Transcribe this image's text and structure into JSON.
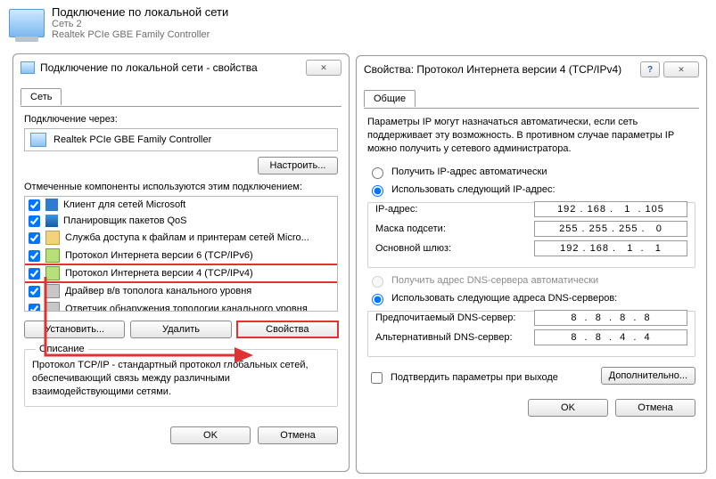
{
  "header": {
    "title": "Подключение по локальной сети",
    "sub1": "Сеть 2",
    "sub2": "Realtek PCIe GBE Family Controller"
  },
  "dlg1": {
    "title": "Подключение по локальной сети - свойства",
    "tab": "Сеть",
    "connect_via": "Подключение через:",
    "adapter": "Realtek PCIe GBE Family Controller",
    "configure": "Настроить...",
    "components_label": "Отмеченные компоненты используются этим подключением:",
    "items": [
      "Клиент для сетей Microsoft",
      "Планировщик пакетов QoS",
      "Служба доступа к файлам и принтерам сетей Micro...",
      "Протокол Интернета версии 6 (TCP/IPv6)",
      "Протокол Интернета версии 4 (TCP/IPv4)",
      "Драйвер в/в тополога канального уровня",
      "Ответчик обнаружения топологии канального уровня"
    ],
    "install": "Установить...",
    "remove": "Удалить",
    "properties": "Свойства",
    "desc_title": "Описание",
    "desc": "Протокол TCP/IP - стандартный протокол глобальных сетей, обеспечивающий связь между различными взаимодействующими сетями.",
    "ok": "OK",
    "cancel": "Отмена"
  },
  "dlg2": {
    "title": "Свойства: Протокол Интернета версии 4 (TCP/IPv4)",
    "tab": "Общие",
    "intro": "Параметры IP могут назначаться автоматически, если сеть поддерживает эту возможность. В противном случае параметры IP можно получить у сетевого администратора.",
    "r_auto_ip": "Получить IP-адрес автоматически",
    "r_static_ip": "Использовать следующий IP-адрес:",
    "f_ip": "IP-адрес:",
    "f_mask": "Маска подсети:",
    "f_gw": "Основной шлюз:",
    "v_ip": "192 . 168 .   1  . 105",
    "v_mask": "255 . 255 . 255 .   0",
    "v_gw": "192 . 168 .   1  .   1",
    "r_auto_dns": "Получить адрес DNS-сервера автоматически",
    "r_static_dns": "Использовать следующие адреса DNS-серверов:",
    "f_dns1": "Предпочитаемый DNS-сервер:",
    "f_dns2": "Альтернативный DNS-сервер:",
    "v_dns1": "8  .  8  .  8  .  8",
    "v_dns2": "8  .  8  .  4  .  4",
    "confirm": "Подтвердить параметры при выходе",
    "advanced": "Дополнительно...",
    "ok": "OK",
    "cancel": "Отмена"
  }
}
